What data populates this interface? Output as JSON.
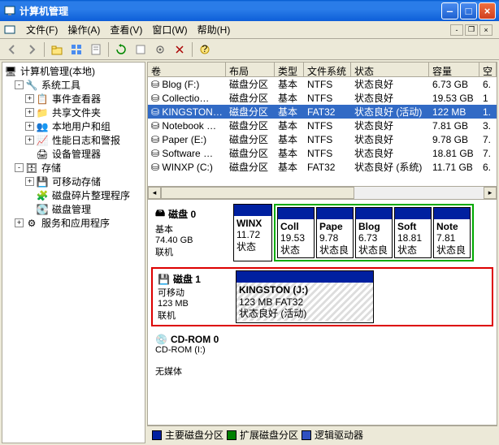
{
  "title": "计算机管理",
  "menu": {
    "file": "文件(F)",
    "action": "操作(A)",
    "view": "查看(V)",
    "window": "窗口(W)",
    "help": "帮助(H)"
  },
  "tree": {
    "root": "计算机管理(本地)",
    "systools": "系统工具",
    "eventviewer": "事件查看器",
    "sharedfolders": "共享文件夹",
    "localusers": "本地用户和组",
    "perflogs": "性能日志和警报",
    "devmgr": "设备管理器",
    "storage": "存储",
    "removable": "可移动存储",
    "defrag": "磁盘碎片整理程序",
    "diskmgmt": "磁盘管理",
    "services": "服务和应用程序"
  },
  "col": {
    "volume": "卷",
    "layout": "布局",
    "type": "类型",
    "fs": "文件系统",
    "status": "状态",
    "capacity": "容量",
    "free": "空"
  },
  "vols": [
    {
      "name": "Blog (F:)",
      "layout": "磁盘分区",
      "type": "基本",
      "fs": "NTFS",
      "status": "状态良好",
      "cap": "6.73 GB",
      "free": "6."
    },
    {
      "name": "Collectio…",
      "layout": "磁盘分区",
      "type": "基本",
      "fs": "NTFS",
      "status": "状态良好",
      "cap": "19.53 GB",
      "free": "1"
    },
    {
      "name": "KINGSTON …",
      "layout": "磁盘分区",
      "type": "基本",
      "fs": "FAT32",
      "status": "状态良好 (活动)",
      "cap": "122 MB",
      "free": "1."
    },
    {
      "name": "Notebook …",
      "layout": "磁盘分区",
      "type": "基本",
      "fs": "NTFS",
      "status": "状态良好",
      "cap": "7.81 GB",
      "free": "3."
    },
    {
      "name": "Paper (E:)",
      "layout": "磁盘分区",
      "type": "基本",
      "fs": "NTFS",
      "status": "状态良好",
      "cap": "9.78 GB",
      "free": "7."
    },
    {
      "name": "Software …",
      "layout": "磁盘分区",
      "type": "基本",
      "fs": "NTFS",
      "status": "状态良好",
      "cap": "18.81 GB",
      "free": "7."
    },
    {
      "name": "WINXP (C:)",
      "layout": "磁盘分区",
      "type": "基本",
      "fs": "FAT32",
      "status": "状态良好 (系统)",
      "cap": "11.71 GB",
      "free": "6."
    }
  ],
  "chart_data": {
    "type": "table",
    "disks": [
      {
        "label": "磁盘 0",
        "kind": "基本",
        "size": "74.40 GB",
        "state": "联机",
        "partitions": [
          {
            "name": "WINX",
            "size": "11.72",
            "status": "状态"
          },
          {
            "name": "Coll",
            "size": "19.53",
            "status": "状态"
          },
          {
            "name": "Pape",
            "size": "9.78",
            "status": "状态良"
          },
          {
            "name": "Blog",
            "size": "6.73",
            "status": "状态良"
          },
          {
            "name": "Soft",
            "size": "18.81",
            "status": "状态"
          },
          {
            "name": "Note",
            "size": "7.81",
            "status": "状态良"
          }
        ]
      },
      {
        "label": "磁盘 1",
        "kind": "可移动",
        "size": "123 MB",
        "state": "联机",
        "partitions": [
          {
            "name": "KINGSTON  (J:)",
            "size": "123 MB FAT32",
            "status": "状态良好 (活动)"
          }
        ]
      },
      {
        "label": "CD-ROM 0",
        "kind": "CD-ROM (I:)",
        "size": "",
        "state": "无媒体",
        "partitions": []
      }
    ]
  },
  "legend": {
    "primary": "主要磁盘分区",
    "extended": "扩展磁盘分区",
    "logical": "逻辑驱动器"
  },
  "colors": {
    "primary": "#0020a0",
    "extended": "#008000",
    "logical": "#3050c0"
  }
}
